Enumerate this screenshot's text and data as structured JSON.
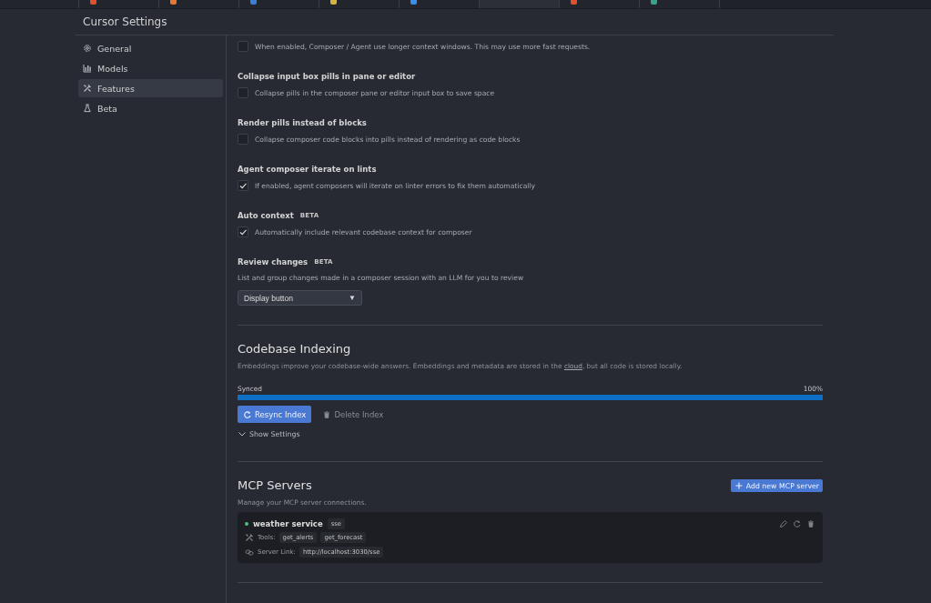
{
  "editor_tabs": [
    {
      "selected": false
    },
    {
      "selected": false,
      "color": "#e0522f"
    },
    {
      "selected": false,
      "color": "#e37933"
    },
    {
      "selected": false,
      "color": "#3b7fd4"
    },
    {
      "selected": false,
      "color": "#d4b340"
    },
    {
      "selected": false,
      "color": "#3b8ee8"
    },
    {
      "selected": true
    },
    {
      "selected": false,
      "color": "#e0522f"
    },
    {
      "selected": false,
      "color": "#3aa38c"
    }
  ],
  "window": {
    "title": "Cursor Settings"
  },
  "sidebar": {
    "items": [
      {
        "label": "General",
        "selected": false
      },
      {
        "label": "Models",
        "selected": false
      },
      {
        "label": "Features",
        "selected": true
      },
      {
        "label": "Beta",
        "selected": false
      }
    ]
  },
  "settings": [
    {
      "kind": "checkbox",
      "description": "When enabled, Composer / Agent use longer context windows. This may use more fast requests.",
      "checked": false
    },
    {
      "kind": "checkbox",
      "title": "Collapse input box pills in pane or editor",
      "description": "Collapse pills in the composer pane or editor input box to save space",
      "checked": false
    },
    {
      "kind": "checkbox",
      "title": "Render pills instead of blocks",
      "description": "Collapse composer code blocks into pills instead of rendering as code blocks",
      "checked": false
    },
    {
      "kind": "checkbox",
      "title": "Agent composer iterate on lints",
      "description": "If enabled, agent composers will iterate on linter errors to fix them automatically",
      "checked": true
    },
    {
      "kind": "checkbox",
      "title": "Auto context",
      "badge": "BETA",
      "description": "Automatically include relevant codebase context for composer",
      "checked": true
    },
    {
      "kind": "select",
      "title": "Review changes",
      "badge": "BETA",
      "description": "List and group changes made in a composer session with an LLM for you to review",
      "value": "Display button",
      "arrow": "▼"
    }
  ],
  "codebase_indexing": {
    "title": "Codebase Indexing",
    "description": {
      "before": "Embeddings improve your codebase-wide answers. Embeddings and metadata are stored in the ",
      "link": "cloud",
      "after": ", but all code is stored locally."
    },
    "progress": {
      "label": "Synced",
      "reading": "100%",
      "level": 1
    },
    "buttons": [
      {
        "label": "Resync Index",
        "kind": "primary"
      },
      {
        "label": "Delete Index",
        "kind": "ghost"
      }
    ],
    "show_settings": {
      "label": "Show Settings",
      "expanded": false
    }
  },
  "mcp_servers": {
    "title": "MCP Servers",
    "add_button": "Add new MCP server",
    "description": "Manage your MCP server connections.",
    "servers": [
      {
        "name": "weather service",
        "color": "#4cc27a",
        "transport": "sse",
        "tools_label": "Tools:",
        "tools": [
          "get_alerts",
          "get_forecast"
        ],
        "link_label": "Server Link:",
        "url": "http://localhost:3030/sse"
      }
    ]
  }
}
